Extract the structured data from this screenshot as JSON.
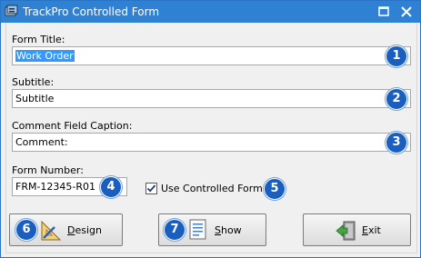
{
  "window": {
    "title": "TrackPro Controlled Form"
  },
  "fields": {
    "form_title": {
      "label": "Form Title:",
      "value": "Work Order",
      "badge": "1"
    },
    "subtitle": {
      "label": "Subtitle:",
      "value": "Subtitle",
      "badge": "2"
    },
    "comment_caption": {
      "label": "Comment Field Caption:",
      "value": "Comment:",
      "badge": "3"
    },
    "form_number": {
      "label": "Form Number:",
      "value": "FRM-12345-R01",
      "badge": "4"
    }
  },
  "controlled_form": {
    "label": "Use Controlled Form",
    "checked": true,
    "badge": "5"
  },
  "buttons": {
    "design": {
      "label_first": "D",
      "label_rest": "esign",
      "badge": "6",
      "icon": "triangle-ruler-icon"
    },
    "show": {
      "label_first": "S",
      "label_rest": "how",
      "badge": "7",
      "icon": "form-preview-icon"
    },
    "exit": {
      "label_first": "E",
      "label_rest": "xit",
      "icon": "exit-door-icon"
    }
  },
  "colors": {
    "titlebar": "#2f82d3",
    "badge": "#1a5fbf",
    "selection": "#3399ff"
  }
}
